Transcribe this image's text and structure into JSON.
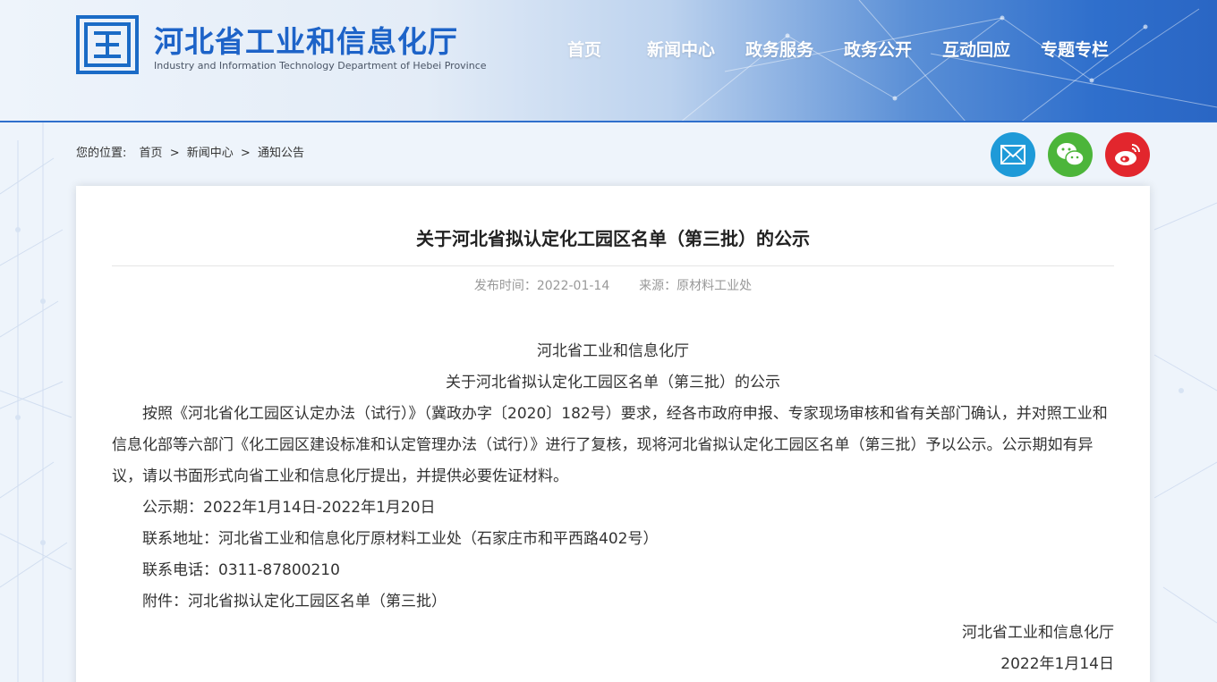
{
  "header": {
    "title": "河北省工业和信息化厅",
    "subtitle": "Industry and Information Technology Department of Hebei Province",
    "nav": [
      "首页",
      "新闻中心",
      "政务服务",
      "政务公开",
      "互动回应",
      "专题专栏"
    ]
  },
  "breadcrumb": {
    "lead": "您的位置:",
    "items": [
      "首页",
      "新闻中心",
      "通知公告"
    ],
    "separator": ">"
  },
  "share": {
    "icons": [
      "email-icon",
      "wechat-icon",
      "weibo-icon"
    ],
    "colors": {
      "email": "#1e9ad8",
      "wechat": "#4cb53a",
      "weibo": "#e2262d"
    }
  },
  "article": {
    "title": "关于河北省拟认定化工园区名单（第三批）的公示",
    "publish_label": "发布时间：",
    "publish_date": "2022-01-14",
    "source_label": "来源：",
    "source": "原材料工业处",
    "org_heading": "河北省工业和信息化厅",
    "sub_heading": "关于河北省拟认定化工园区名单（第三批）的公示",
    "paragraph": "按照《河北省化工园区认定办法（试行）》（冀政办字〔2020〕182号）要求，经各市政府申报、专家现场审核和省有关部门确认，并对照工业和信息化部等六部门《化工园区建设标准和认定管理办法（试行）》进行了复核，现将河北省拟认定化工园区名单（第三批）予以公示。公示期如有异议，请以书面形式向省工业和信息化厅提出，并提供必要佐证材料。",
    "period": "公示期：2022年1月14日-2022年1月20日",
    "address": "联系地址：河北省工业和信息化厅原材料工业处（石家庄市和平西路402号）",
    "phone": "联系电话：0311-87800210",
    "attachment": "附件：河北省拟认定化工园区名单（第三批）",
    "signature_org": "河北省工业和信息化厅",
    "signature_date": "2022年1月14日"
  },
  "theme": {
    "brand_blue": "#1d63c8",
    "header_blue": "#2f6fcc"
  }
}
